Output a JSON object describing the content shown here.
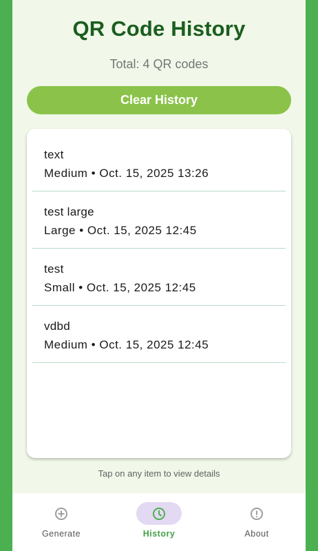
{
  "header": {
    "title": "QR Code History",
    "total": "Total: 4 QR codes"
  },
  "actions": {
    "clear_label": "Clear History"
  },
  "history": [
    {
      "name": "text",
      "meta": "Medium • Oct. 15, 2025 13:26"
    },
    {
      "name": "test large",
      "meta": "Large • Oct. 15, 2025 12:45"
    },
    {
      "name": "test",
      "meta": "Small • Oct. 15, 2025 12:45"
    },
    {
      "name": "vdbd",
      "meta": "Medium • Oct. 15, 2025 12:45"
    }
  ],
  "hint": "Tap on any item to view details",
  "nav": [
    {
      "label": "Generate",
      "icon": "plus-circle-icon",
      "active": false
    },
    {
      "label": "History",
      "icon": "clock-icon",
      "active": true
    },
    {
      "label": "About",
      "icon": "info-icon",
      "active": false
    }
  ],
  "colors": {
    "brand_green": "#4caf50",
    "title_green": "#1b5e20",
    "button_green": "#8bc34a",
    "active_tab": "#43a047",
    "active_pill": "#e3d9f3"
  }
}
